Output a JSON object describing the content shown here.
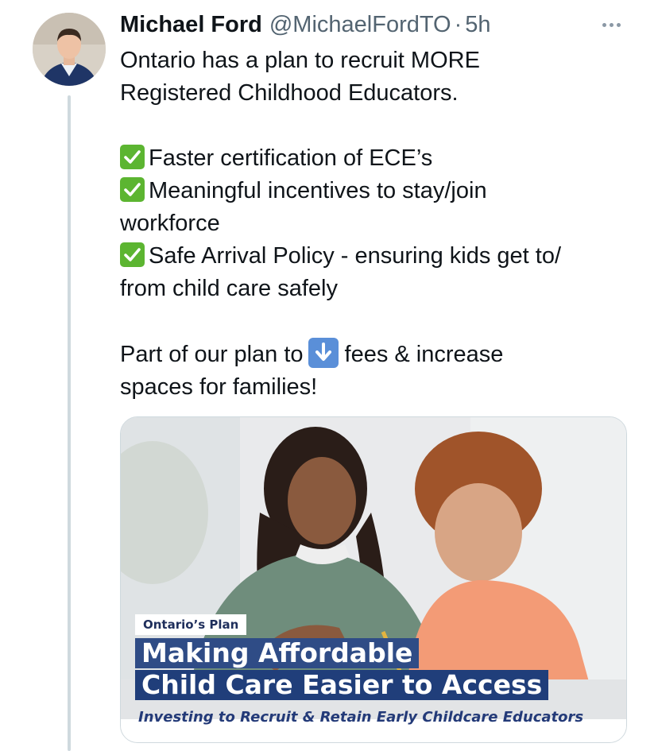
{
  "tweet": {
    "author_name": "Michael Ford",
    "handle": "@MichaelFordTO",
    "separator": "·",
    "time": "5h",
    "lines": {
      "l1": "Ontario has a plan to recruit MORE",
      "l2": "Registered Childhood Educators.",
      "l3": "Faster certification of ECE’s",
      "l4": "Meaningful incentives to stay/join",
      "l5": "workforce",
      "l6": "Safe Arrival Policy - ensuring kids get to/",
      "l7": "from child care safely",
      "l8a": "Part of our plan to",
      "l8b": "fees & increase",
      "l9": "spaces for families!"
    },
    "icons": {
      "checkmark": "check-mark-button-emoji",
      "down_arrow": "down-arrow-emoji",
      "more": "more-options-icon"
    }
  },
  "media": {
    "kicker": "Ontario’s Plan",
    "headline_line1": "Making Affordable",
    "headline_line2": "Child Care Easier to Access",
    "subline": "Investing to Recruit & Retain Early Childcare Educators"
  },
  "colors": {
    "text": "#0f1419",
    "secondary_text": "#536471",
    "check_green": "#5cb531",
    "arrow_blue": "#5a8fd8",
    "headline_blue": "#2f4c86"
  }
}
